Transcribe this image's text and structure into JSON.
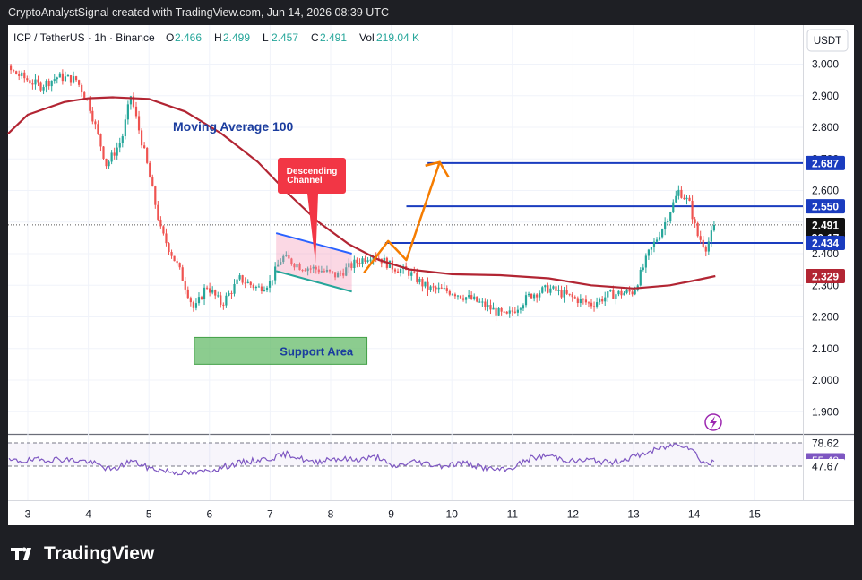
{
  "header": {
    "credit": "CryptoAnalystSignal created with TradingView.com, Jun 14, 2026 08:39 UTC"
  },
  "legend": {
    "symbol": "ICP / TetherUS · 1h · Binance",
    "o_label": "O",
    "o": "2.466",
    "h_label": "H",
    "h": "2.499",
    "l_label": "L",
    "l": "2.457",
    "c_label": "C",
    "c": "2.491",
    "vol_label": "Vol",
    "vol": "219.04 K"
  },
  "currency_button": "USDT",
  "annotations": {
    "ma_label": "Moving Average 100",
    "channel_label": "Descending Channel",
    "support_label": "Support Area"
  },
  "price_axis": {
    "ticks": [
      "3.000",
      "2.900",
      "2.800",
      "2.700",
      "2.600",
      "2.500",
      "2.400",
      "2.300",
      "2.200",
      "2.100",
      "2.000",
      "1.900"
    ],
    "tags": [
      {
        "text": "2.687",
        "value": 2.687,
        "color": "#1a3cbf"
      },
      {
        "text": "2.550",
        "value": 2.55,
        "color": "#1a3cbf"
      },
      {
        "text": "2.491",
        "value": 2.491,
        "color": "#111111"
      },
      {
        "text": "20:17",
        "value": 2.466,
        "color": "#111111"
      },
      {
        "text": "2.434",
        "value": 2.434,
        "color": "#1a3cbf"
      },
      {
        "text": "2.329",
        "value": 2.329,
        "color": "#b22533"
      }
    ]
  },
  "rsi_axis": {
    "tags": [
      {
        "text": "78.62",
        "value": 78.62,
        "color": "#ffffff",
        "fg": "#131722"
      },
      {
        "text": "55.48",
        "value": 55.48,
        "color": "#7e57c2",
        "fg": "#ffffff"
      },
      {
        "text": "47.67",
        "value": 47.67,
        "color": "#ffffff",
        "fg": "#131722"
      }
    ]
  },
  "time_axis": {
    "labels": [
      "3",
      "4",
      "5",
      "6",
      "7",
      "8",
      "9",
      "10",
      "11",
      "12",
      "13",
      "14",
      "15"
    ]
  },
  "brand": "TradingView",
  "colors": {
    "up": "#26a69a",
    "down": "#ef5350",
    "ma": "#b22533",
    "level": "#1a3cbf",
    "arrow": "#f57c00",
    "rsi": "#7e57c2",
    "support": "#4caf50"
  },
  "chart_data": {
    "type": "candlestick",
    "title": "ICP / TetherUS · 1h · Binance",
    "y_range": [
      1.85,
      3.07
    ],
    "x_range": [
      "3",
      "15"
    ],
    "close_path": [
      {
        "x": 2.0,
        "y": 2.98
      },
      {
        "x": 2.3,
        "y": 2.95
      },
      {
        "x": 2.6,
        "y": 2.99
      },
      {
        "x": 2.9,
        "y": 2.96
      },
      {
        "x": 3.2,
        "y": 2.93
      },
      {
        "x": 3.5,
        "y": 2.96
      },
      {
        "x": 3.8,
        "y": 2.95
      },
      {
        "x": 4.0,
        "y": 2.88
      },
      {
        "x": 4.3,
        "y": 2.68
      },
      {
        "x": 4.55,
        "y": 2.76
      },
      {
        "x": 4.7,
        "y": 2.9
      },
      {
        "x": 4.95,
        "y": 2.7
      },
      {
        "x": 5.2,
        "y": 2.47
      },
      {
        "x": 5.5,
        "y": 2.35
      },
      {
        "x": 5.75,
        "y": 2.22
      },
      {
        "x": 5.95,
        "y": 2.3
      },
      {
        "x": 6.2,
        "y": 2.24
      },
      {
        "x": 6.5,
        "y": 2.32
      },
      {
        "x": 6.8,
        "y": 2.29
      },
      {
        "x": 7.0,
        "y": 2.31
      },
      {
        "x": 7.2,
        "y": 2.39
      },
      {
        "x": 7.5,
        "y": 2.36
      },
      {
        "x": 7.8,
        "y": 2.35
      },
      {
        "x": 8.1,
        "y": 2.33
      },
      {
        "x": 8.4,
        "y": 2.37
      },
      {
        "x": 8.7,
        "y": 2.4
      },
      {
        "x": 9.0,
        "y": 2.36
      },
      {
        "x": 9.3,
        "y": 2.34
      },
      {
        "x": 9.6,
        "y": 2.29
      },
      {
        "x": 10.0,
        "y": 2.28
      },
      {
        "x": 10.4,
        "y": 2.25
      },
      {
        "x": 10.9,
        "y": 2.2
      },
      {
        "x": 11.3,
        "y": 2.27
      },
      {
        "x": 11.6,
        "y": 2.29
      },
      {
        "x": 12.0,
        "y": 2.26
      },
      {
        "x": 12.3,
        "y": 2.24
      },
      {
        "x": 12.6,
        "y": 2.27
      },
      {
        "x": 13.0,
        "y": 2.28
      },
      {
        "x": 13.25,
        "y": 2.4
      },
      {
        "x": 13.5,
        "y": 2.49
      },
      {
        "x": 13.75,
        "y": 2.6
      },
      {
        "x": 13.92,
        "y": 2.56
      },
      {
        "x": 14.05,
        "y": 2.46
      },
      {
        "x": 14.2,
        "y": 2.42
      },
      {
        "x": 14.35,
        "y": 2.491
      }
    ],
    "series": [
      {
        "name": "Moving Average 100",
        "points": [
          {
            "x": 2.0,
            "y": 2.78
          },
          {
            "x": 3.0,
            "y": 2.84
          },
          {
            "x": 3.6,
            "y": 2.88
          },
          {
            "x": 4.0,
            "y": 2.892
          },
          {
            "x": 4.4,
            "y": 2.895
          },
          {
            "x": 5.0,
            "y": 2.89
          },
          {
            "x": 5.6,
            "y": 2.85
          },
          {
            "x": 6.2,
            "y": 2.78
          },
          {
            "x": 6.8,
            "y": 2.69
          },
          {
            "x": 7.3,
            "y": 2.59
          },
          {
            "x": 7.8,
            "y": 2.5
          },
          {
            "x": 8.3,
            "y": 2.43
          },
          {
            "x": 8.8,
            "y": 2.38
          },
          {
            "x": 9.3,
            "y": 2.35
          },
          {
            "x": 10.0,
            "y": 2.335
          },
          {
            "x": 10.8,
            "y": 2.332
          },
          {
            "x": 11.6,
            "y": 2.322
          },
          {
            "x": 12.3,
            "y": 2.3
          },
          {
            "x": 13.0,
            "y": 2.29
          },
          {
            "x": 13.6,
            "y": 2.3
          },
          {
            "x": 14.0,
            "y": 2.315
          },
          {
            "x": 14.35,
            "y": 2.329
          }
        ]
      },
      {
        "name": "RSI",
        "points": [
          {
            "x": 2.0,
            "y": 56
          },
          {
            "x": 2.5,
            "y": 54
          },
          {
            "x": 3.0,
            "y": 55
          },
          {
            "x": 3.5,
            "y": 57
          },
          {
            "x": 4.0,
            "y": 54
          },
          {
            "x": 4.4,
            "y": 42
          },
          {
            "x": 4.7,
            "y": 55
          },
          {
            "x": 5.0,
            "y": 45
          },
          {
            "x": 5.4,
            "y": 40
          },
          {
            "x": 5.75,
            "y": 38
          },
          {
            "x": 6.1,
            "y": 44
          },
          {
            "x": 6.5,
            "y": 52
          },
          {
            "x": 7.0,
            "y": 58
          },
          {
            "x": 7.3,
            "y": 64
          },
          {
            "x": 7.7,
            "y": 52
          },
          {
            "x": 8.0,
            "y": 58
          },
          {
            "x": 8.4,
            "y": 56
          },
          {
            "x": 8.8,
            "y": 60
          },
          {
            "x": 9.0,
            "y": 46
          },
          {
            "x": 9.4,
            "y": 54
          },
          {
            "x": 9.8,
            "y": 48
          },
          {
            "x": 10.2,
            "y": 52
          },
          {
            "x": 10.6,
            "y": 44
          },
          {
            "x": 10.9,
            "y": 42
          },
          {
            "x": 11.3,
            "y": 58
          },
          {
            "x": 11.6,
            "y": 62
          },
          {
            "x": 12.0,
            "y": 54
          },
          {
            "x": 12.3,
            "y": 56
          },
          {
            "x": 12.6,
            "y": 52
          },
          {
            "x": 13.0,
            "y": 60
          },
          {
            "x": 13.4,
            "y": 70
          },
          {
            "x": 13.75,
            "y": 78
          },
          {
            "x": 13.95,
            "y": 72
          },
          {
            "x": 14.1,
            "y": 56
          },
          {
            "x": 14.25,
            "y": 50
          },
          {
            "x": 14.35,
            "y": 55.48
          }
        ]
      }
    ],
    "levels": [
      2.687,
      2.55,
      2.434
    ],
    "current_price": 2.491,
    "countdown": "20:17",
    "ma100_value": 2.329,
    "rsi": {
      "value": 55.48,
      "bands": [
        78.62,
        47.67
      ]
    },
    "support_zone": {
      "x_from": 5.75,
      "x_to": 8.6,
      "y_from": 2.05,
      "y_to": 2.135
    },
    "channel": {
      "upper": [
        {
          "x": 7.1,
          "y": 2.465
        },
        {
          "x": 8.35,
          "y": 2.4
        }
      ],
      "lower": [
        {
          "x": 7.1,
          "y": 2.345
        },
        {
          "x": 8.35,
          "y": 2.28
        }
      ]
    },
    "projection_arrow": [
      {
        "x": 8.55,
        "y": 2.34
      },
      {
        "x": 8.95,
        "y": 2.44
      },
      {
        "x": 9.25,
        "y": 2.38
      },
      {
        "x": 9.8,
        "y": 2.69
      }
    ],
    "pointer": {
      "x": 7.75,
      "y": 2.37
    }
  }
}
